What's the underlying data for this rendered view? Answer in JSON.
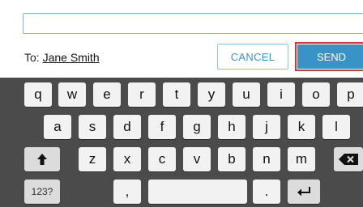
{
  "compose": {
    "message_value": "",
    "to_label": "To:",
    "recipient": "Jane Smith",
    "cancel_label": "CANCEL",
    "send_label": "SEND"
  },
  "keyboard": {
    "row1": [
      "q",
      "w",
      "e",
      "r",
      "t",
      "y",
      "u",
      "i",
      "o",
      "p"
    ],
    "row2": [
      "a",
      "s",
      "d",
      "f",
      "g",
      "h",
      "j",
      "k",
      "l"
    ],
    "row3": [
      "z",
      "x",
      "c",
      "v",
      "b",
      "n",
      "m"
    ],
    "numbers_label": "123?",
    "comma_label": ",",
    "period_label": "."
  },
  "icons": {
    "shift": "shift-arrow-icon",
    "backspace": "backspace-icon",
    "enter": "enter-return-icon"
  },
  "colors": {
    "accent": "#3a93c6",
    "highlight_border": "#d9352b",
    "keyboard_bg": "#4b4b4b",
    "key_bg": "#f2f2f2"
  }
}
